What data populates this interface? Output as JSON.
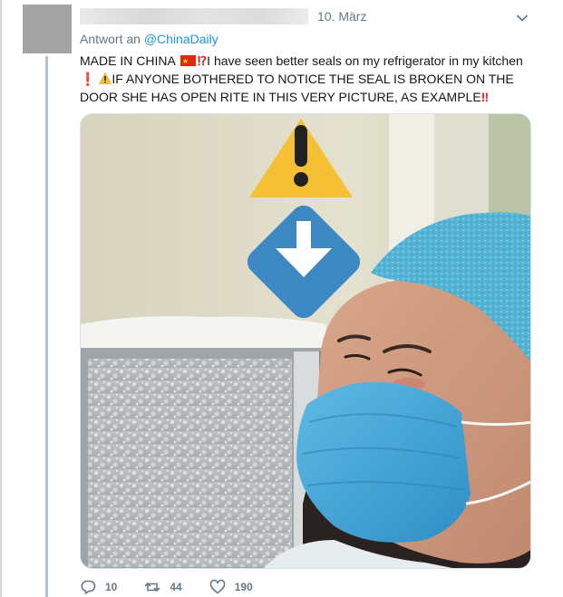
{
  "tweet": {
    "author_name_redacted": true,
    "date": "10. März",
    "reply_prefix": "Antwort an",
    "reply_handle": "@ChinaDaily",
    "text": {
      "part1": "MADE IN CHINA",
      "part2": "I have seen better seals on my refrigerator in my kitchen",
      "part3": "IF ANYONE BOTHERED TO NOTICE THE SEAL IS BROKEN ON THE DOOR SHE HAS OPEN RITE IN THIS VERY PICTURE, AS EXAMPLE"
    },
    "emojis": [
      "flag-cn",
      "exclamation-question",
      "red-exclamation",
      "warning-sign",
      "double-exclamation"
    ],
    "media": {
      "description_icons": [
        "warning-sign-icon",
        "down-arrow-icon"
      ]
    },
    "actions": {
      "reply_count": "10",
      "retweet_count": "44",
      "like_count": "190"
    }
  },
  "colors": {
    "link": "#1b95e0",
    "secondary_text": "#657786",
    "thread_line": "#b6c3cc",
    "mask_blue": "#3aa6d8",
    "cap_blue": "#5bb8d6",
    "warning_yellow": "#f5c033",
    "arrow_blue": "#3b88c3"
  }
}
